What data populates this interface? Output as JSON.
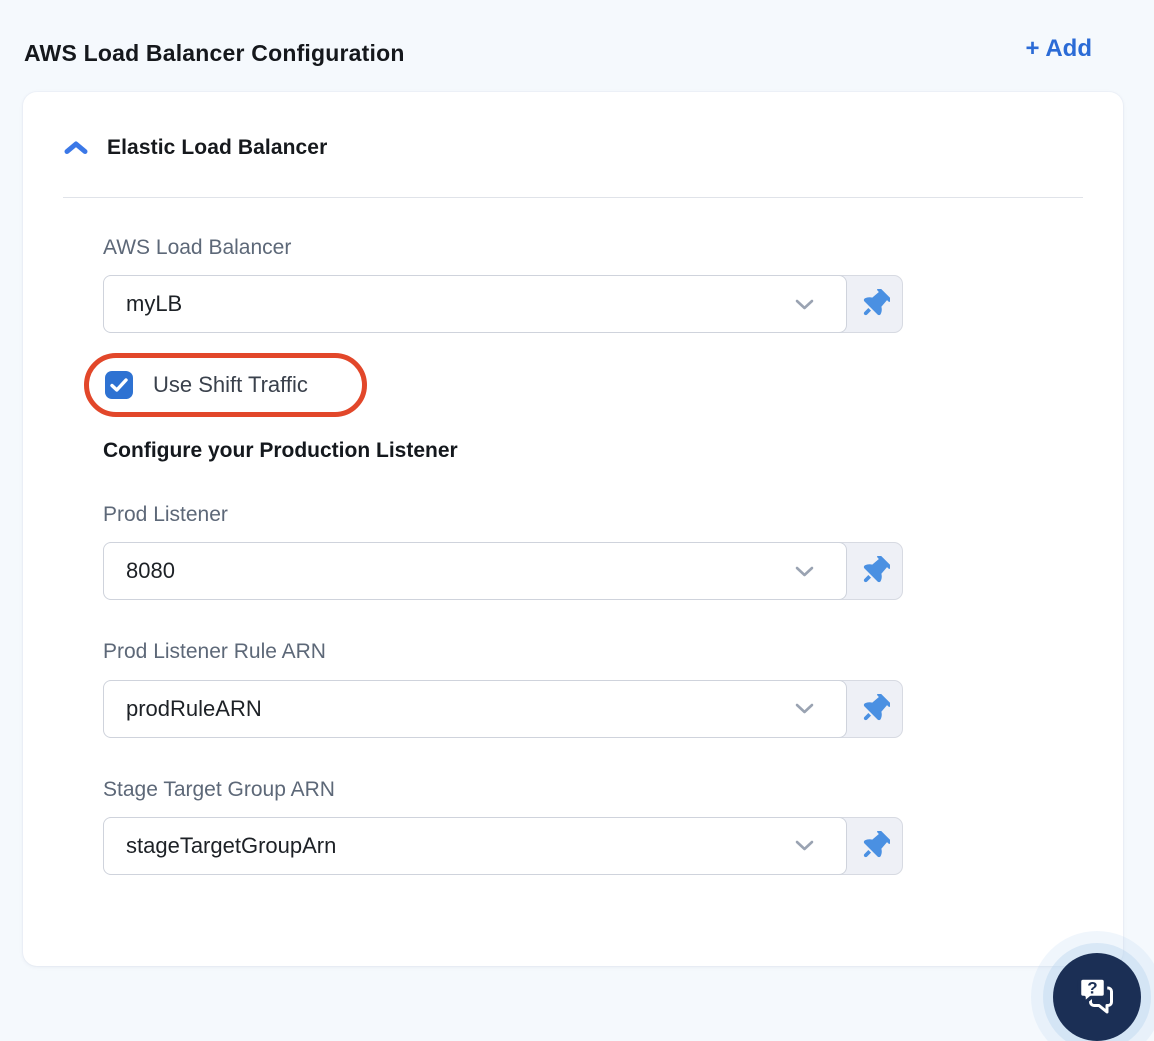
{
  "header": {
    "title": "AWS Load Balancer Configuration",
    "add_button_label": "+ Add"
  },
  "panel": {
    "section_title": "Elastic Load Balancer",
    "section_expanded": true,
    "fields": [
      {
        "label": "AWS Load Balancer",
        "value": "myLB"
      },
      {
        "label": "Prod Listener",
        "value": "8080"
      },
      {
        "label": "Prod Listener Rule ARN",
        "value": "prodRuleARN"
      },
      {
        "label": "Stage Target Group ARN",
        "value": "stageTargetGroupArn"
      }
    ],
    "checkbox": {
      "label": "Use Shift Traffic",
      "checked": true
    },
    "sub_heading": "Configure your Production Listener"
  },
  "annotation": {
    "shape": "rounded-rectangle-highlight",
    "color": "#e2472a"
  },
  "icons": {
    "section_toggle": "chevron-up-icon",
    "dropdown": "chevron-down-icon",
    "pin": "pushpin-icon",
    "checkbox": "checkmark-icon",
    "help": "chat-question-icon"
  },
  "colors": {
    "page_background": "#f5f9fd",
    "card_background": "#ffffff",
    "accent_blue": "#2b6bd6",
    "checkbox_blue": "#2e72d2",
    "pin_blue": "#4a90e2",
    "annotation_red": "#e2472a",
    "chat_fab_navy": "#1b2f55"
  }
}
